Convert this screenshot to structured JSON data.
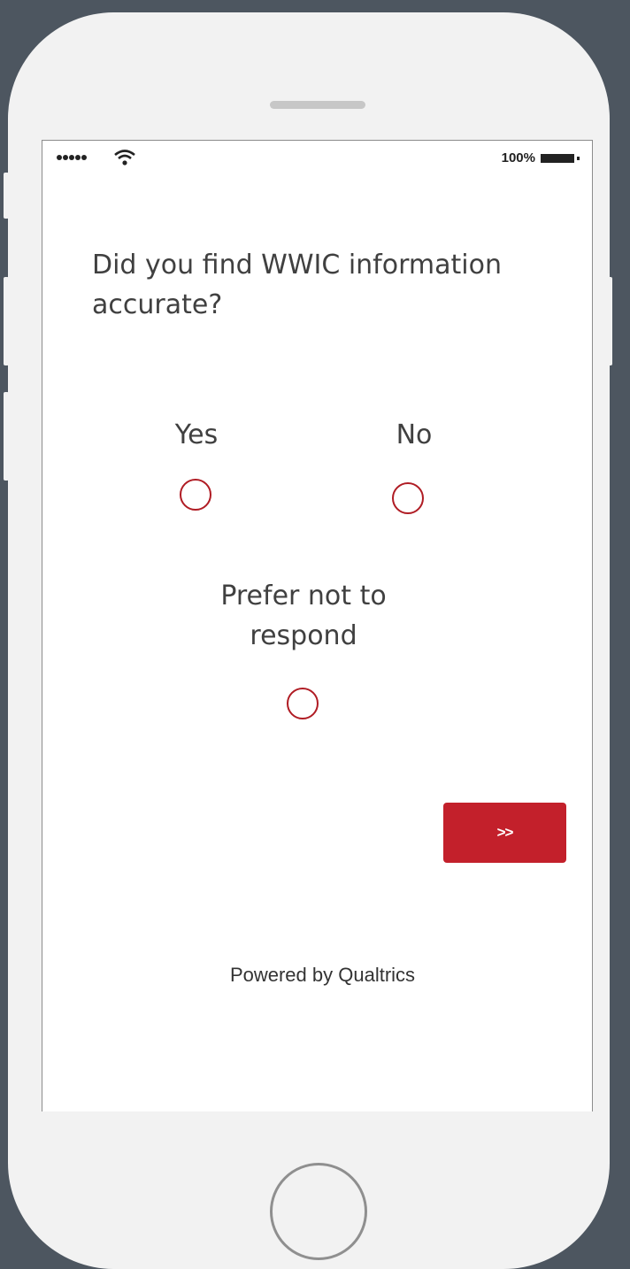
{
  "status_bar": {
    "battery_percent": "100%",
    "signal_icon": "signal-dots-icon",
    "wifi_icon": "wifi-icon",
    "battery_icon": "battery-icon"
  },
  "survey": {
    "question": "Did you find WWIC information accurate?",
    "options": [
      {
        "label": "Yes"
      },
      {
        "label": "No"
      },
      {
        "label": "Prefer not to respond"
      }
    ],
    "next_button_label": ">>",
    "footer": "Powered by Qualtrics"
  },
  "colors": {
    "accent": "#c3202b",
    "radio_border": "#b01c24",
    "background": "#4d5660",
    "phone_body": "#f2f2f2"
  }
}
